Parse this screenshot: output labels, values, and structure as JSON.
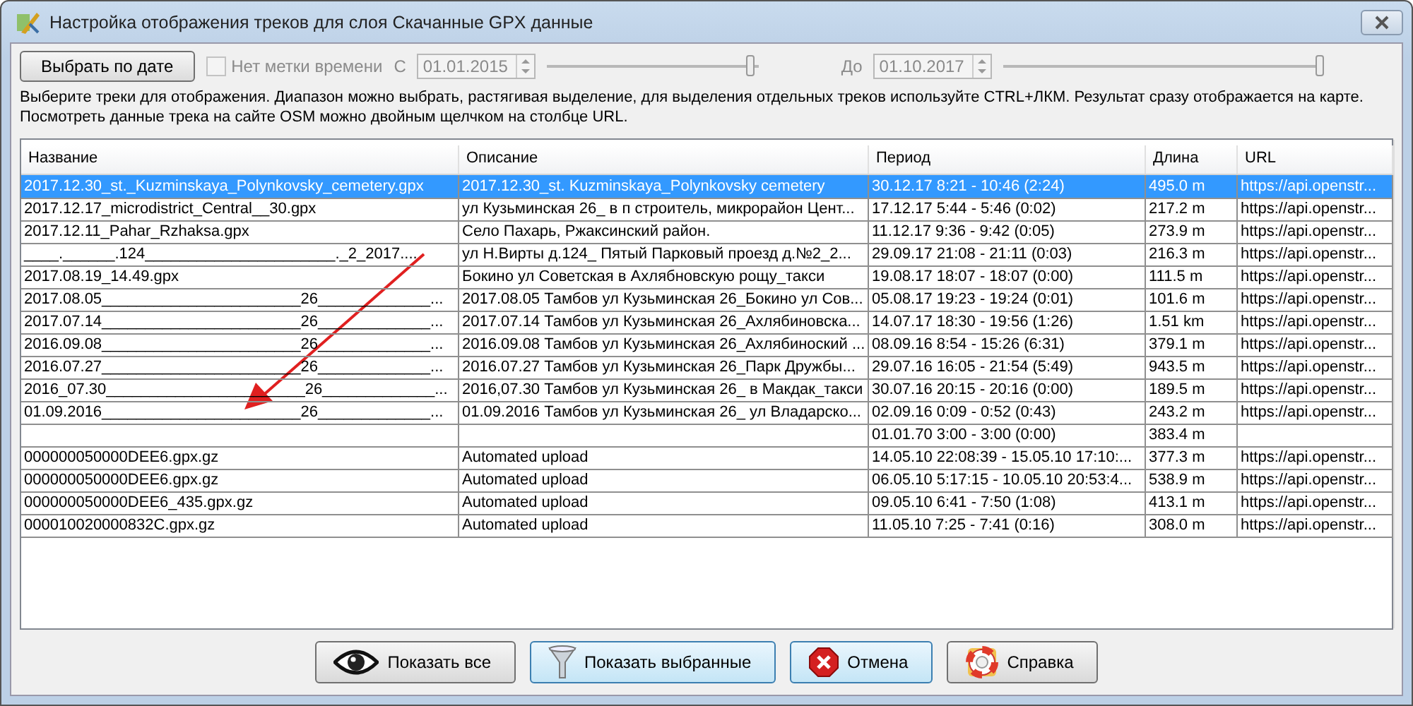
{
  "window": {
    "title": "Настройка отображения треков для слоя Скачанные GPX данные"
  },
  "toolbar": {
    "date_button": "Выбрать по дате",
    "no_timestamp": {
      "label": "Нет метки времени",
      "checked": false,
      "disabled": true
    },
    "from_label": "С",
    "from_date": {
      "value": "01.01.2015",
      "disabled": true
    },
    "from_slider": {
      "level": 0.96
    },
    "to_label": "До",
    "to_date": {
      "value": "01.10.2017",
      "disabled": true
    },
    "to_slider": {
      "level": 0.99
    }
  },
  "hint": [
    "Выберите треки для отображения. Диапазон можно выбрать, растягивая выделение, для выделения отдельных треков используйте CTRL+ЛКМ. Результат сразу отображается на карте.",
    "Посмотреть данные трека на сайте OSM можно двойным щелчком на столбце URL."
  ],
  "table": {
    "columns": [
      "Название",
      "Описание",
      "Период",
      "Длина",
      "URL"
    ],
    "rows": [
      {
        "selected": true,
        "cells": [
          "2017.12.30_st._Kuzminskaya_Polynkovsky_cemetery.gpx",
          "2017.12.30_st. Kuzminskaya_Polynkovsky cemetery",
          "30.12.17 8:21 - 10:46 (2:24)",
          "495.0 m",
          "https://api.openstr..."
        ]
      },
      {
        "selected": false,
        "cells": [
          "2017.12.17_microdistrict_Central__30.gpx",
          "ул Кузьминская 26_ в п строитель, микрорайон Цент...",
          "17.12.17 5:44 - 5:46 (0:02)",
          "217.2 m",
          "https://api.openstr..."
        ]
      },
      {
        "selected": false,
        "cells": [
          "2017.12.11_Pahar_Rzhaksa.gpx",
          "Село Пахарь, Ржаксинский район.",
          "11.12.17 9:36 - 9:42 (0:05)",
          "273.9 m",
          "https://api.openstr..."
        ]
      },
      {
        "selected": false,
        "cells": [
          "____.______.124______________________._2_2017....",
          "ул Н.Вирты д.124_ Пятый Парковый проезд д.№2_2...",
          "29.09.17 21:08 - 21:11 (0:03)",
          "216.3 m",
          "https://api.openstr..."
        ]
      },
      {
        "selected": false,
        "cells": [
          "2017.08.19_14.49.gpx",
          "Бокино ул Советская в Ахлябновскую рощу_такси",
          "19.08.17 18:07 - 18:07 (0:00)",
          "111.5 m",
          "https://api.openstr..."
        ]
      },
      {
        "selected": false,
        "cells": [
          "2017.08.05_______________________26_____________...",
          "2017.08.05 Тамбов ул Кузьминская 26_Бокино ул Сов...",
          "05.08.17 19:23 - 19:24 (0:01)",
          "101.6 m",
          "https://api.openstr..."
        ]
      },
      {
        "selected": false,
        "cells": [
          "2017.07.14_______________________26_____________...",
          "2017.07.14 Тамбов ул Кузьминская 26_Ахлябиновска...",
          "14.07.17 18:30 - 19:56 (1:26)",
          "1.51 km",
          "https://api.openstr..."
        ]
      },
      {
        "selected": false,
        "cells": [
          "2016.09.08_______________________26_____________...",
          "2016.09.08 Тамбов ул Кузьминская 26_Ахлябиноский ...",
          "08.09.16 8:54 - 15:26 (6:31)",
          "379.1 m",
          "https://api.openstr..."
        ]
      },
      {
        "selected": false,
        "cells": [
          "2016.07.27_______________________26_____________...",
          "2016.07.27 Тамбов ул Кузьминская 26_Парк Дружбы...",
          "29.07.16 16:05 - 21:54 (5:49)",
          "943.5 m",
          "https://api.openstr..."
        ]
      },
      {
        "selected": false,
        "cells": [
          "2016_07.30_______________________26_____________...",
          "2016,07.30 Тамбов ул Кузьминская 26_ в Макдак_такси",
          "30.07.16 20:15 - 20:16 (0:00)",
          "189.5 m",
          "https://api.openstr..."
        ]
      },
      {
        "selected": false,
        "cells": [
          "01.09.2016_______________________26_____________...",
          "01.09.2016 Тамбов ул Кузьминская 26_ ул Владарско...",
          "02.09.16 0:09 - 0:52 (0:43)",
          "243.2 m",
          "https://api.openstr..."
        ]
      },
      {
        "selected": false,
        "cells": [
          "",
          "",
          "01.01.70 3:00 - 3:00 (0:00)",
          "383.4 m",
          ""
        ]
      },
      {
        "selected": false,
        "cells": [
          "000000050000DEE6.gpx.gz",
          "Automated upload",
          "14.05.10 22:08:39 - 15.05.10 17:10:...",
          "377.3 m",
          "https://api.openstr..."
        ]
      },
      {
        "selected": false,
        "cells": [
          "000000050000DEE6.gpx.gz",
          "Automated upload",
          "06.05.10 5:17:15 - 10.05.10 20:53:4...",
          "538.9 m",
          "https://api.openstr..."
        ]
      },
      {
        "selected": false,
        "cells": [
          "000000050000DEE6_435.gpx.gz",
          "Automated upload",
          "09.05.10 6:41 - 7:50 (1:08)",
          "413.1 m",
          "https://api.openstr..."
        ]
      },
      {
        "selected": false,
        "cells": [
          "000010020000832C.gpx.gz",
          "Automated upload",
          "11.05.10 7:25 - 7:41 (0:16)",
          "308.0 m",
          "https://api.openstr..."
        ]
      }
    ]
  },
  "buttons": [
    {
      "kind": "eye",
      "label": "Показать все",
      "highlighted": false
    },
    {
      "kind": "funnel",
      "label": "Показать выбранные",
      "highlighted": true
    },
    {
      "kind": "cancel",
      "label": "Отмена",
      "highlighted": true
    },
    {
      "kind": "help",
      "label": "Справка",
      "highlighted": false
    }
  ]
}
